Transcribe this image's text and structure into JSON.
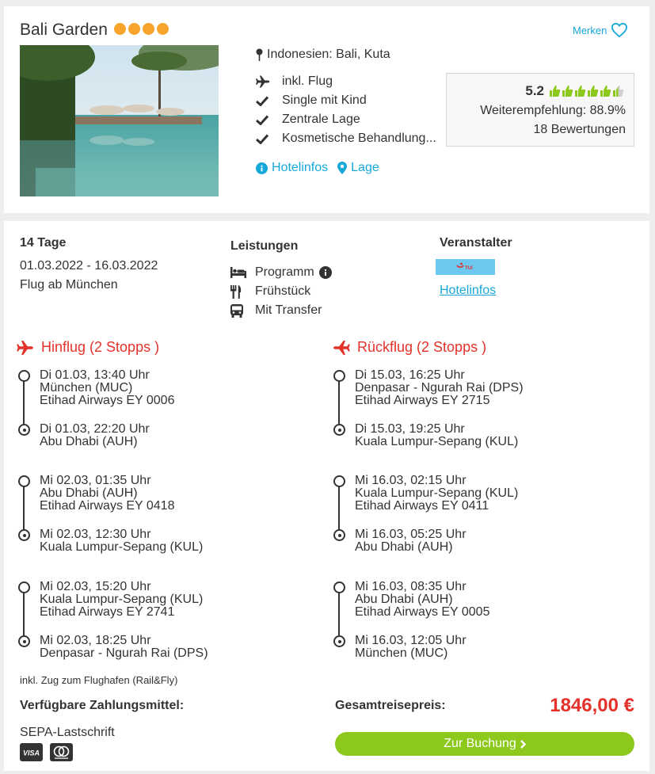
{
  "hotel": {
    "name": "Bali Garden",
    "star_count": 4,
    "save_label": "Merken",
    "location": "Indonesien: Bali, Kuta",
    "features": [
      "inkl. Flug",
      "Single mit Kind",
      "Zentrale Lage",
      "Kosmetische Behandlung..."
    ],
    "rating": {
      "score": "5.2",
      "thumbs_filled": 5.5,
      "thumbs_total": 6,
      "recommendation": "Weiterempfehlung: 88.9%",
      "reviews": "18 Bewertungen"
    },
    "links": {
      "hotelinfos": "Hotelinfos",
      "lage": "Lage"
    }
  },
  "trip": {
    "duration": "14 Tage",
    "dates": "01.03.2022 - 16.03.2022",
    "departure": "Flug ab München",
    "services_title": "Leistungen",
    "services": [
      {
        "icon": "bed-icon",
        "label": "Programm",
        "info": true
      },
      {
        "icon": "cutlery-icon",
        "label": "Frühstück",
        "info": false
      },
      {
        "icon": "bus-icon",
        "label": "Mit Transfer",
        "info": false
      }
    ],
    "operator_title": "Veranstalter",
    "operator_logo_text": "TUI",
    "operator_link": "Hotelinfos"
  },
  "outbound": {
    "title": "Hinflug (2 Stopps )",
    "segments": [
      {
        "dep_time": "Di 01.03, 13:40 Uhr",
        "dep_airport": "München (MUC)",
        "airline": "Etihad Airways EY 0006",
        "arr_time": "Di 01.03, 22:20 Uhr",
        "arr_airport": "Abu Dhabi (AUH)"
      },
      {
        "dep_time": "Mi 02.03, 01:35 Uhr",
        "dep_airport": "Abu Dhabi (AUH)",
        "airline": "Etihad Airways EY 0418",
        "arr_time": "Mi 02.03, 12:30 Uhr",
        "arr_airport": "Kuala Lumpur-Sepang (KUL)"
      },
      {
        "dep_time": "Mi 02.03, 15:20 Uhr",
        "dep_airport": "Kuala Lumpur-Sepang (KUL)",
        "airline": "Etihad Airways EY 2741",
        "arr_time": "Mi 02.03, 18:25 Uhr",
        "arr_airport": "Denpasar - Ngurah Rai (DPS)"
      }
    ]
  },
  "return": {
    "title": "Rückflug (2 Stopps )",
    "segments": [
      {
        "dep_time": "Di 15.03, 16:25 Uhr",
        "dep_airport": "Denpasar - Ngurah Rai (DPS)",
        "airline": "Etihad Airways EY 2715",
        "arr_time": "Di 15.03, 19:25 Uhr",
        "arr_airport": "Kuala Lumpur-Sepang (KUL)"
      },
      {
        "dep_time": "Mi 16.03, 02:15 Uhr",
        "dep_airport": "Kuala Lumpur-Sepang (KUL)",
        "airline": "Etihad Airways EY 0411",
        "arr_time": "Mi 16.03, 05:25 Uhr",
        "arr_airport": "Abu Dhabi (AUH)"
      },
      {
        "dep_time": "Mi 16.03, 08:35 Uhr",
        "dep_airport": "Abu Dhabi (AUH)",
        "airline": "Etihad Airways EY 0005",
        "arr_time": "Mi 16.03, 12:05 Uhr",
        "arr_airport": "München (MUC)"
      }
    ]
  },
  "rail_note": "inkl. Zug zum Flughafen (Rail&Fly)",
  "payment": {
    "label": "Verfügbare Zahlungsmittel:",
    "method": "SEPA-Lastschrift",
    "card_icons": [
      "visa-icon",
      "mastercard-icon"
    ],
    "visa_text": "VISA"
  },
  "total": {
    "label": "Gesamtreisepreis:",
    "price": "1846,00 €",
    "book_label": "Zur Buchung"
  },
  "colors": {
    "accent_blue": "#17a8d9",
    "accent_red": "#e4322b",
    "star_orange": "#f7a42c",
    "thumb_green": "#8dc81d",
    "button_green": "#8dc81d"
  }
}
